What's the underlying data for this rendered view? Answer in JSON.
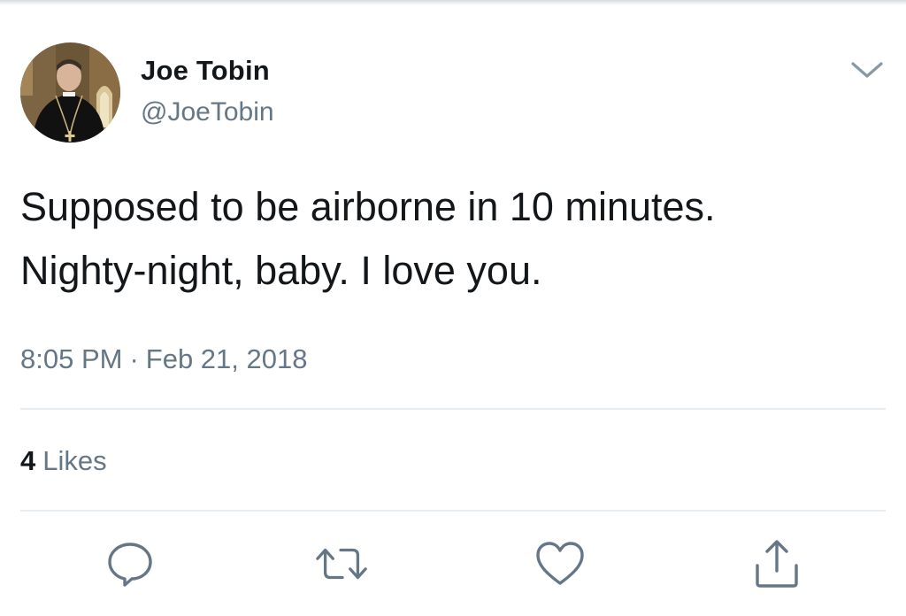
{
  "user": {
    "display_name": "Joe Tobin",
    "handle": "@JoeTobin"
  },
  "tweet": {
    "lines": [
      "Supposed to be airborne in 10 minutes.",
      "Nighty-night, baby. I love you."
    ],
    "time": "8:05 PM",
    "separator": "·",
    "date": "Feb 21, 2018"
  },
  "stats": {
    "likes_count": "4",
    "likes_label": "Likes"
  },
  "icons": {
    "menu": "chevron-down-icon",
    "reply": "reply-icon",
    "retweet": "retweet-icon",
    "like": "heart-icon",
    "share": "share-icon"
  },
  "colors": {
    "text_primary": "#14171a",
    "text_secondary": "#657786",
    "divider": "#e6ecf0"
  }
}
